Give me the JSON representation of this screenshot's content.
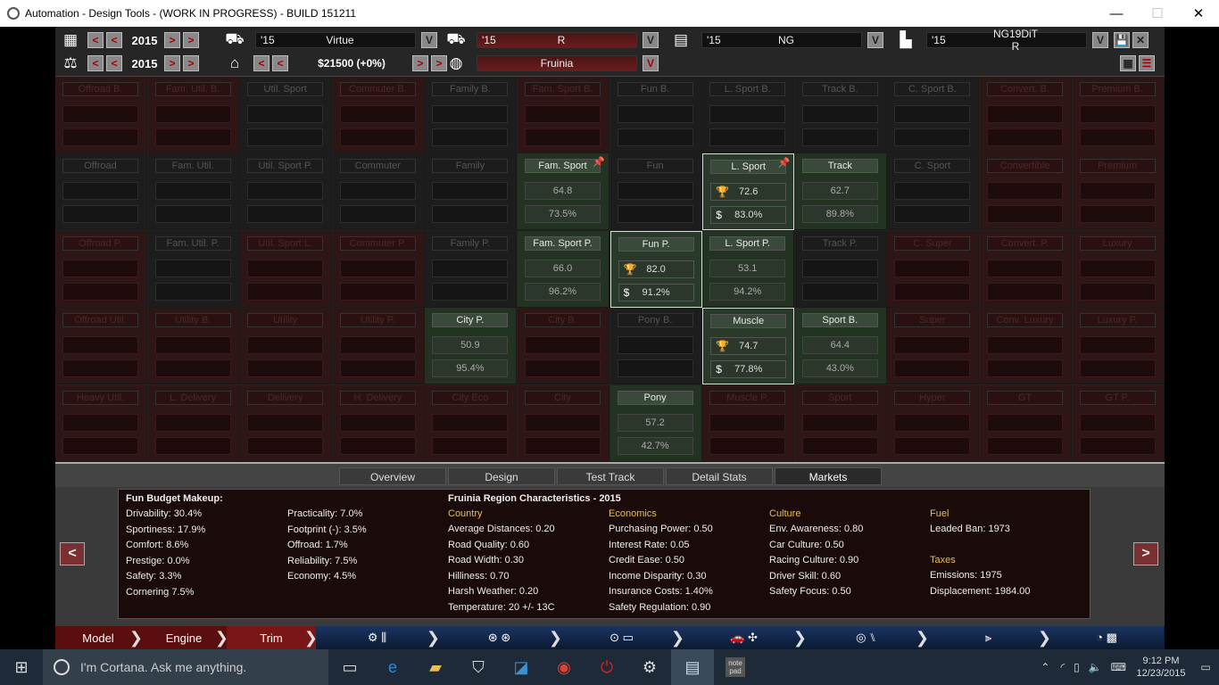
{
  "window": {
    "title": "Automation - Design Tools - (WORK IN PROGRESS) - BUILD 151211",
    "minimize": "—",
    "maximize": "☐",
    "close": "✕"
  },
  "toolbar": {
    "year1": "2015",
    "year2": "2015",
    "model": {
      "year": "'15",
      "name": "Virtue"
    },
    "trim": {
      "year": "'15",
      "name": "R"
    },
    "family": {
      "year": "'15",
      "name": "NG"
    },
    "variant": {
      "year": "'15",
      "name": "NG19DiT R"
    },
    "price": "$21500 (+0%)",
    "region": "Fruinia",
    "btn_prev": "<",
    "btn_next": ">",
    "btn_dd": "V",
    "btn_save": "💾",
    "btn_close": "✕"
  },
  "markets": [
    [
      "Offroad B.",
      "Fam. Util. B.",
      "Util. Sport",
      "Commuter B.",
      "Family B.",
      "Fam. Sport B.",
      "Fun B.",
      "L. Sport B.",
      "Track B.",
      "C. Sport B.",
      "Convert. B.",
      "Premium B."
    ],
    [
      "Offroad",
      "Fam. Util.",
      "Util. Sport P.",
      "Commuter",
      "Family",
      "Fam. Sport",
      "Fun",
      "L. Sport",
      "Track",
      "C. Sport",
      "Convertible",
      "Premium"
    ],
    [
      "Offroad P.",
      "Fam. Util. P.",
      "Util. Sport L.",
      "Commuter P.",
      "Family P.",
      "Fam. Sport P.",
      "Fun P.",
      "L. Sport P.",
      "Track P.",
      "C. Super",
      "Convert. P.",
      "Luxury"
    ],
    [
      "Offroad Util.",
      "Utility B.",
      "Utility",
      "Utility P.",
      "City P.",
      "City B.",
      "Pony B.",
      "Muscle",
      "Sport B.",
      "Super",
      "Conv. Luxury",
      "Luxury P."
    ],
    [
      "Heavy Util.",
      "L. Delivery",
      "Delivery",
      "H. Delivery",
      "City Eco",
      "City",
      "Pony",
      "Muscle P.",
      "Sport",
      "Hyper",
      "GT",
      "GT P."
    ]
  ],
  "scores": {
    "1-5": {
      "a": "64.8",
      "b": "73.5%"
    },
    "1-7": {
      "a": "72.6",
      "b": "83.0%"
    },
    "1-8": {
      "a": "62.7",
      "b": "89.8%"
    },
    "2-5": {
      "a": "66.0",
      "b": "96.2%"
    },
    "2-6": {
      "a": "82.0",
      "b": "91.2%"
    },
    "2-7": {
      "a": "53.1",
      "b": "94.2%"
    },
    "3-4": {
      "a": "50.9",
      "b": "95.4%"
    },
    "3-7": {
      "a": "74.7",
      "b": "77.8%"
    },
    "3-8": {
      "a": "64.4",
      "b": "43.0%"
    },
    "4-6": {
      "a": "57.2",
      "b": "42.7%"
    }
  },
  "tabs": [
    "Overview",
    "Design",
    "Test Track",
    "Detail Stats",
    "Markets"
  ],
  "panel": {
    "budget_title": "Fun Budget Makeup:",
    "budget_col1": [
      "Drivability: 30.4%",
      "Sportiness: 17.9%",
      "Comfort: 8.6%",
      "Prestige: 0.0%",
      "Safety: 3.3%",
      "Cornering 7.5%"
    ],
    "budget_col2": [
      "Practicality: 7.0%",
      "Footprint (-): 3.5%",
      "Offroad: 1.7%",
      "Reliability: 7.5%",
      "Economy: 4.5%"
    ],
    "region_title": "Fruinia Region Characteristics - 2015",
    "country_head": "Country",
    "country": [
      "Average Distances: 0.20",
      "Road Quality: 0.60",
      "Road Width: 0.30",
      "Hilliness: 0.70",
      "Harsh Weather: 0.20",
      "Temperature: 20 +/- 13C"
    ],
    "econ_head": "Economics",
    "econ": [
      "Purchasing Power: 0.50",
      "Interest Rate: 0.05",
      "Credit Ease: 0.50",
      "Income Disparity: 0.30",
      "Insurance Costs: 1.40%",
      "Safety Regulation: 0.90"
    ],
    "culture_head": "Culture",
    "culture": [
      "Env. Awareness: 0.80",
      "Car Culture: 0.50",
      "Racing Culture: 0.90",
      "Driver Skill: 0.60",
      "Safety Focus: 0.50"
    ],
    "fuel_head": "Fuel",
    "fuel": [
      "Leaded Ban: 1973"
    ],
    "taxes_head": "Taxes",
    "taxes": [
      "Emissions: 1975",
      "Displacement: 1984.00"
    ],
    "prev": "<",
    "next": ">"
  },
  "nav": {
    "model": "Model",
    "engine": "Engine",
    "trim": "Trim"
  },
  "taskbar": {
    "search": "I'm Cortana. Ask me anything.",
    "time": "9:12 PM",
    "date": "12/23/2015",
    "notepad": "note pad"
  }
}
